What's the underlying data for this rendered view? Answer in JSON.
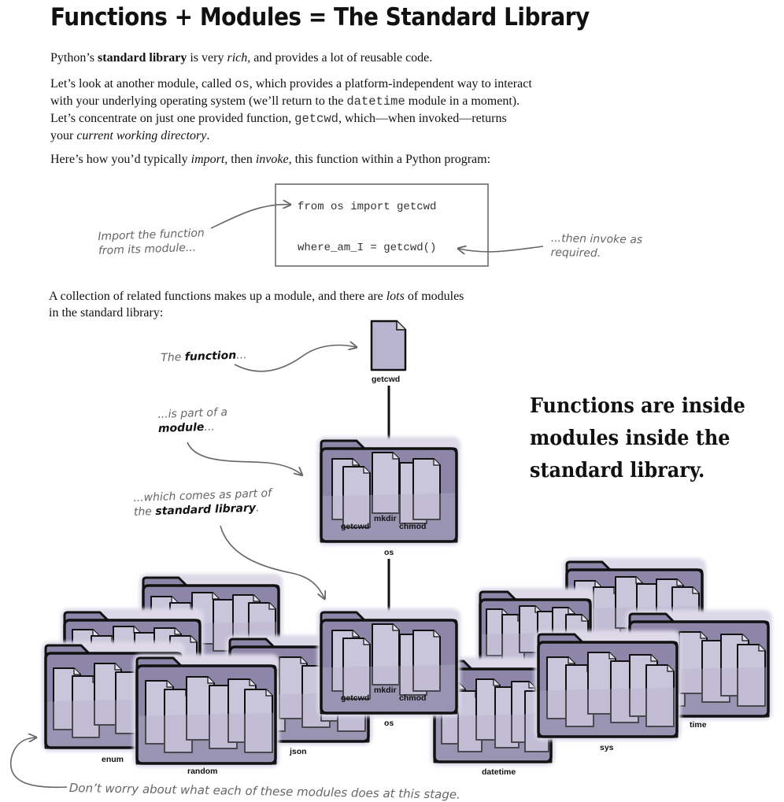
{
  "title": "Functions + Modules = The Standard Library",
  "p1": {
    "a": "Python’s ",
    "b": "standard library",
    "c": " is very ",
    "d": "rich",
    "e": ", and provides a lot of reusable code."
  },
  "p2": {
    "a": "Let’s look at another module, called ",
    "os": "os",
    "b": ", which provides a platform-independent way to interact with your underlying operating system (we’ll return to the ",
    "datetime": "datetime",
    "c": " module in a moment). Let’s concentrate on just one provided function, ",
    "getcwd": "getcwd",
    "d": ", which—when invoked—returns your ",
    "e": "current working directory",
    "f": "."
  },
  "p3": {
    "a": "Here’s how you’d typically ",
    "b": "import",
    "c": ", then ",
    "d": "invoke",
    "e": ", this function within a Python program:"
  },
  "code": {
    "line1": "from os import getcwd",
    "line2": "where_am_I = getcwd()"
  },
  "notes": {
    "import_l1": "Import the function",
    "import_l2": "from its module...",
    "invoke_l1": "...then invoke as",
    "invoke_l2": "required.",
    "func_a": "The ",
    "func_b": "function",
    "func_c": "...",
    "mod_l1": "...is part of a",
    "mod_b": "module",
    "mod_c": "...",
    "lib_l1": "...which comes as part of",
    "lib_a": "the ",
    "lib_b": "standard library",
    "lib_c": ".",
    "bottom": "Don’t worry about what each of these modules does at this stage."
  },
  "p4": {
    "a": "A collection of related functions makes up a module, and there are ",
    "b": "lots",
    "c": " of modules in the standard library:"
  },
  "callout": {
    "l1": "Functions are inside",
    "l2": "modules inside the",
    "l3": "standard library."
  },
  "labels": {
    "getcwd": "getcwd",
    "os_getcwd": "getcwd",
    "os_mkdir": "mkdir",
    "os_chmod": "chmod",
    "os": "os",
    "lib_getcwd": "getcwd",
    "lib_mkdir": "mkdir",
    "lib_chmod": "chmod",
    "lib_os": "os",
    "enum": "enum",
    "random": "random",
    "json": "json",
    "datetime": "datetime",
    "sys": "sys",
    "time": "time"
  },
  "colors": {
    "folder_fill": "#b4afc9",
    "folder_dark": "#8d86a8",
    "doc_fill": "#c9c5db",
    "stroke": "#111111",
    "annotation": "#666666"
  }
}
